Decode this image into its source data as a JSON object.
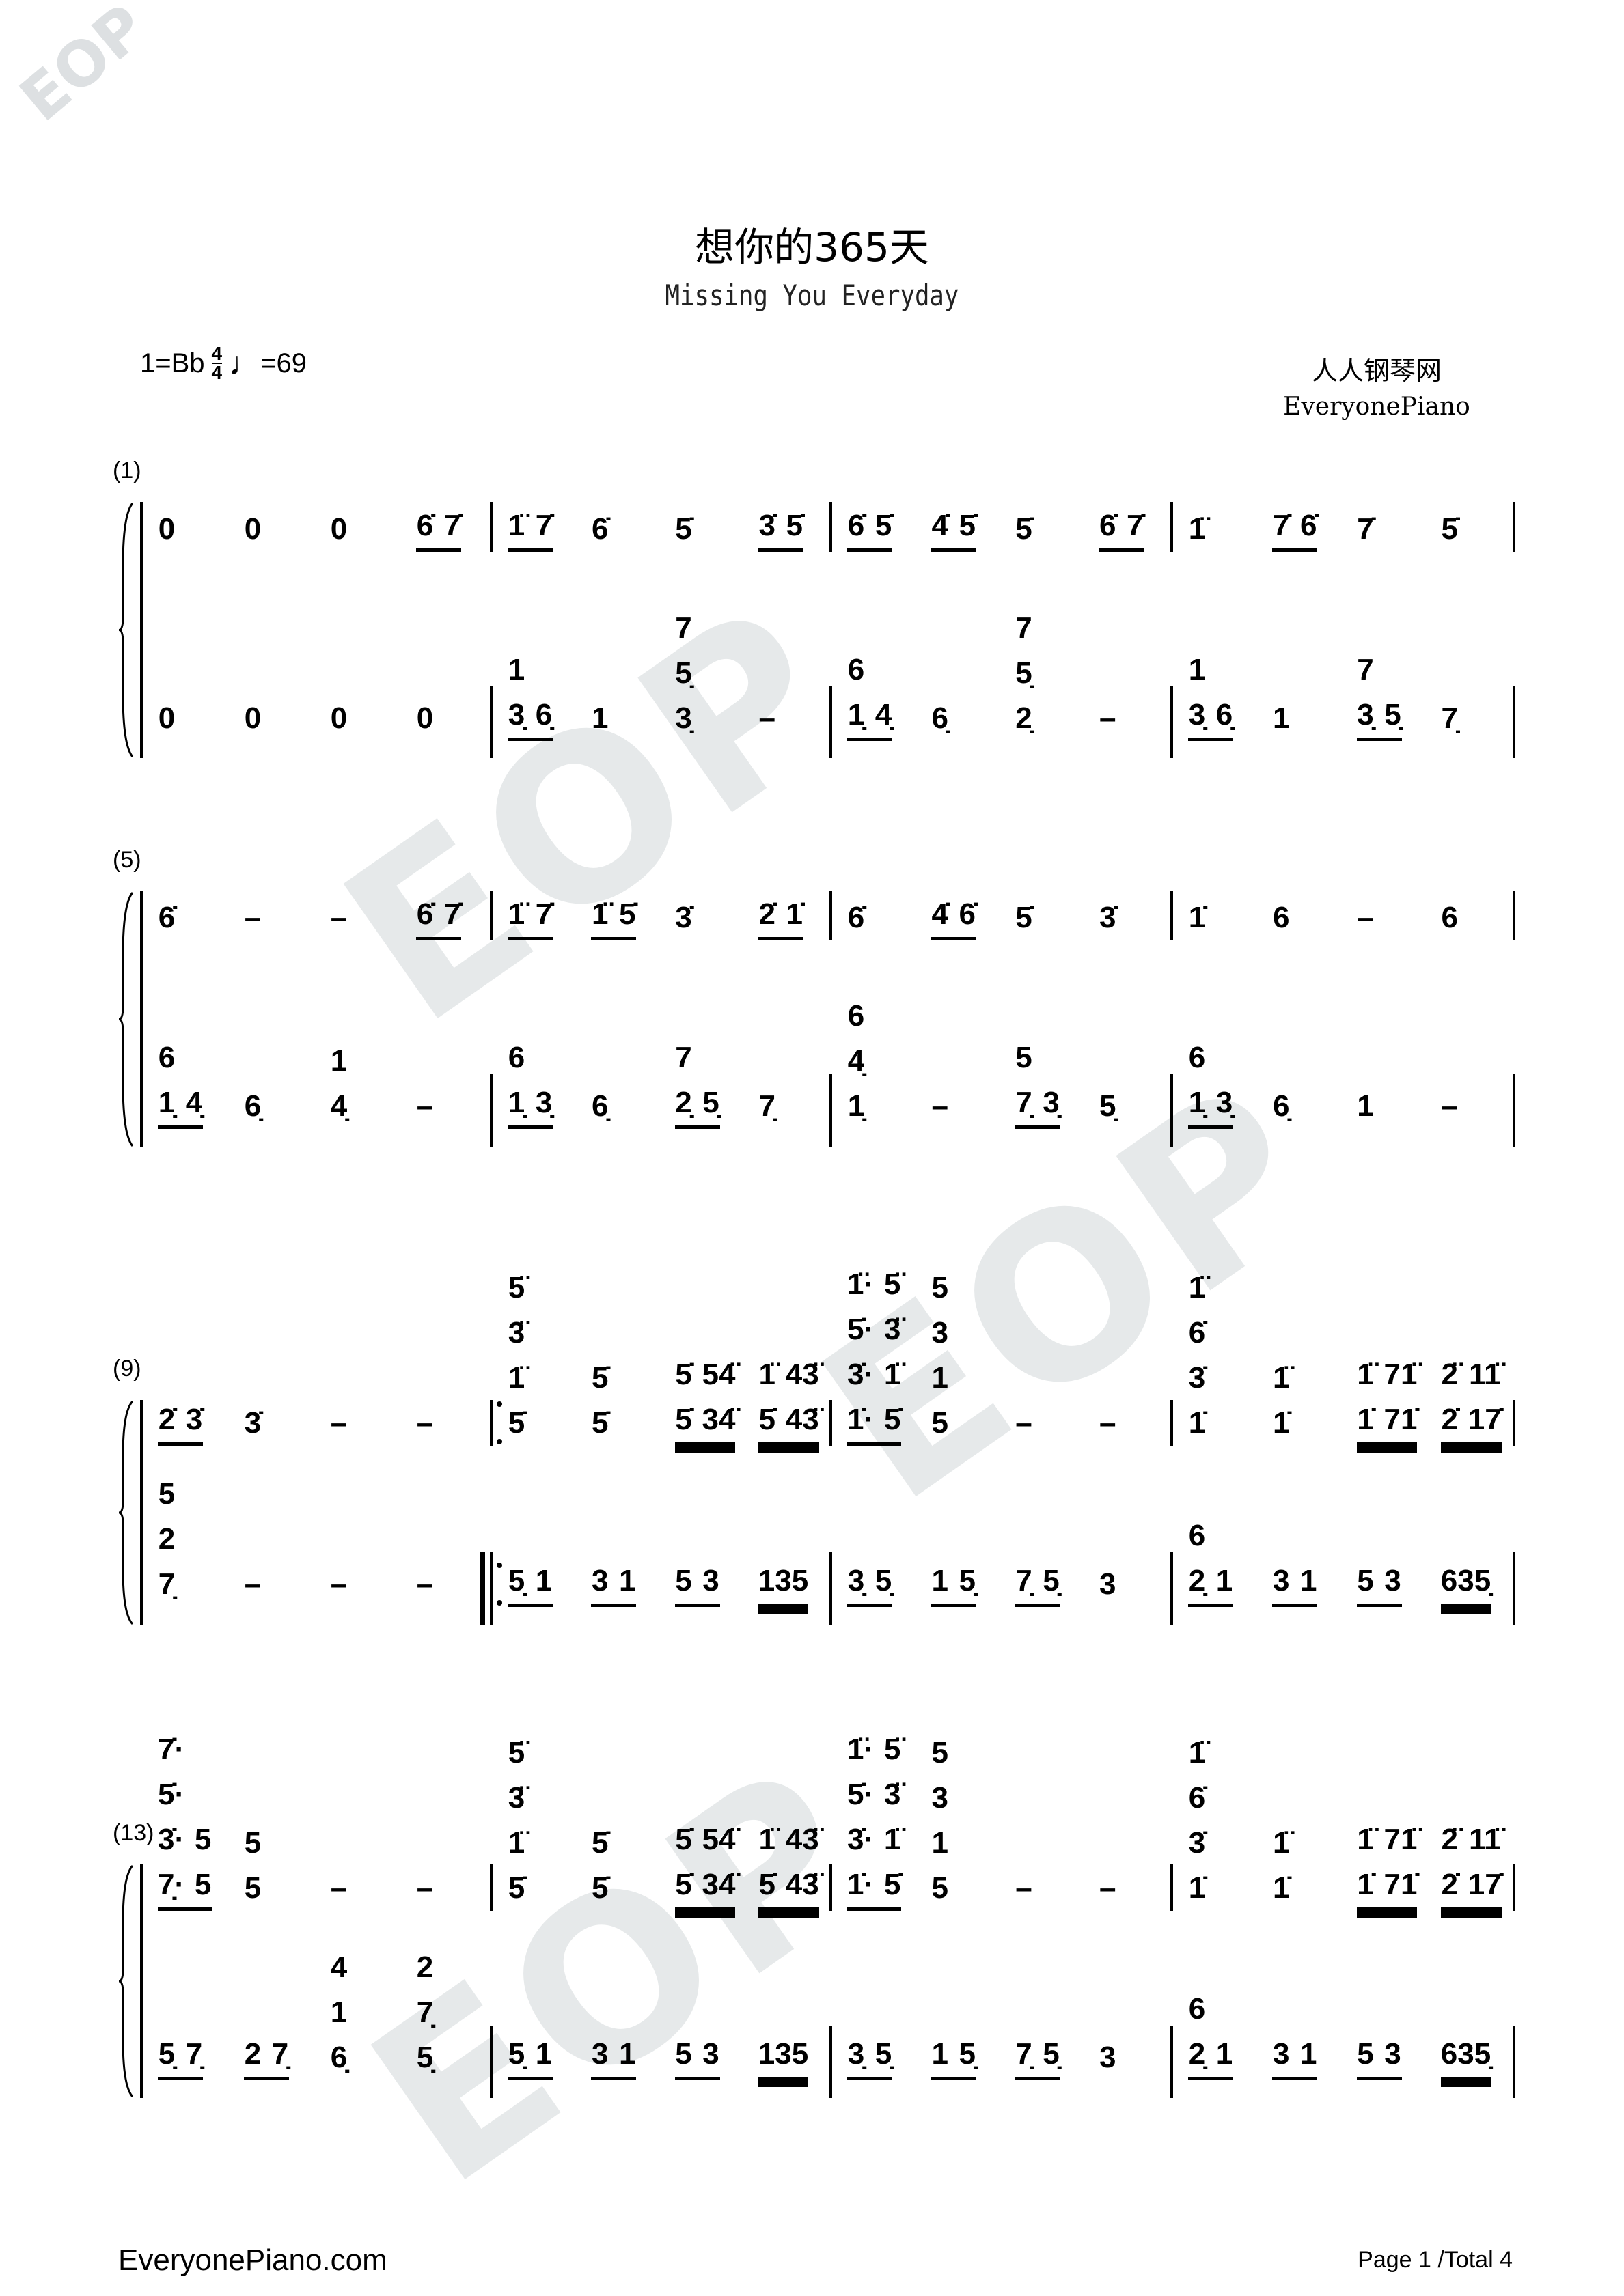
{
  "title": "想你的365天",
  "subtitle": "Missing You Everyday",
  "key": "1=Bb",
  "time_signature": {
    "top": "4",
    "bottom": "4"
  },
  "tempo": "=69",
  "site_cn": "人人钢琴网",
  "site_en": "EveryonePiano",
  "watermark": "EOP",
  "footer": {
    "site": "EveryonePiano.com",
    "page": "Page 1 /Total 4"
  },
  "systems": [
    {
      "label": "(1)",
      "measures": [
        {
          "rh": [
            "0",
            "0",
            "0",
            {
              "u": 1,
              "ev": [
                "6̇",
                "7̇"
              ]
            }
          ],
          "lh": [
            "0",
            "0",
            "0",
            "0"
          ]
        },
        {
          "rh": [
            {
              "u": 1,
              "ev": [
                "1̈",
                "7̇"
              ]
            },
            "6̇",
            "5̇",
            {
              "u": 1,
              "ev": [
                "3̇",
                "5̇"
              ]
            }
          ],
          "lh": [
            {
              "u": 1,
              "ev": [
                "1/3̣",
                "6̣"
              ]
            },
            "1",
            "7/5̣/3̣",
            "–"
          ]
        },
        {
          "rh": [
            {
              "u": 1,
              "ev": [
                "6̇",
                "5̇"
              ]
            },
            {
              "u": 1,
              "ev": [
                "4̇",
                "5̇"
              ]
            },
            "5̇",
            {
              "u": 1,
              "ev": [
                "6̇",
                "7̇"
              ]
            }
          ],
          "lh": [
            {
              "u": 1,
              "ev": [
                "6/1̣",
                "4̣"
              ]
            },
            "6̣",
            "7/5̣/2̣",
            "–"
          ]
        },
        {
          "rh": [
            "1̈",
            {
              "u": 1,
              "ev": [
                "7̇",
                "6̇"
              ]
            },
            "7̇",
            "5̇"
          ],
          "lh": [
            {
              "u": 1,
              "ev": [
                "1/3̣",
                "6̣"
              ]
            },
            "1",
            {
              "u": 1,
              "ev": [
                "7/3̣",
                "5̣"
              ]
            },
            "7̣"
          ]
        }
      ]
    },
    {
      "label": "(5)",
      "measures": [
        {
          "rh": [
            "6̇",
            "–",
            "–",
            {
              "u": 1,
              "ev": [
                "6̇",
                "7̇"
              ]
            }
          ],
          "lh": [
            {
              "u": 1,
              "ev": [
                "6/1̣",
                "4̣"
              ]
            },
            "6̣",
            "1/4̣",
            "–"
          ]
        },
        {
          "rh": [
            {
              "u": 1,
              "ev": [
                "1̈",
                "7̇"
              ]
            },
            {
              "u": 1,
              "ev": [
                "1̈",
                "5̇"
              ]
            },
            "3̇",
            {
              "u": 1,
              "ev": [
                "2̇",
                "1̇"
              ]
            }
          ],
          "lh": [
            {
              "u": 1,
              "ev": [
                "6/1̣",
                "3̣"
              ]
            },
            "6̣",
            {
              "u": 1,
              "ev": [
                "7/2̣",
                "5̣"
              ]
            },
            "7̣"
          ]
        },
        {
          "rh": [
            "6̇",
            {
              "u": 1,
              "ev": [
                "4̇",
                "6̇"
              ]
            },
            "5̇",
            "3̇"
          ],
          "lh": [
            "6/4̣/1̣",
            "–",
            {
              "u": 1,
              "ev": [
                "5/7̣",
                "3̣"
              ]
            },
            "5̣"
          ]
        },
        {
          "rh": [
            "1̇",
            "6",
            "–",
            "6"
          ],
          "lh": [
            {
              "u": 1,
              "ev": [
                "6/1̣",
                "3̣"
              ]
            },
            "6̣",
            "1",
            "–"
          ]
        }
      ]
    },
    {
      "label": "(9)",
      "measures": [
        {
          "rh": [
            {
              "u": 1,
              "ev": [
                "2̇",
                "3̇"
              ]
            },
            "3̇",
            "–",
            "–"
          ],
          "lh": [
            "5/2/7̣",
            "–",
            "–",
            "–"
          ]
        },
        {
          "repeat_start": true,
          "rh": [
            "5̈/3̈/1̈/5̇",
            "5̇/5̇",
            {
              "u": 2,
              "ev": [
                "5̇/5̇",
                "54̈/34̈"
              ]
            },
            {
              "u": 2,
              "ev": [
                "1̈/5̇",
                "43̈/43̈"
              ]
            }
          ],
          "lh": [
            {
              "u": 1,
              "ev": [
                "5̣",
                "1"
              ]
            },
            {
              "u": 1,
              "ev": [
                "3",
                "1"
              ]
            },
            {
              "u": 1,
              "ev": [
                "5",
                "3"
              ]
            },
            {
              "u": 2,
              "ev": [
                "135"
              ]
            }
          ]
        },
        {
          "rh": [
            {
              "u": 1,
              "ev": [
                "1̈·/5̇·/3̇·/1̇·",
                "5̈/3̈/1̈/5̇"
              ]
            },
            "5/3/1/5",
            "–",
            "–"
          ],
          "lh": [
            {
              "u": 1,
              "ev": [
                "3̣",
                "5̣"
              ]
            },
            {
              "u": 1,
              "ev": [
                "1",
                "5̣"
              ]
            },
            {
              "u": 1,
              "ev": [
                "7̣",
                "5̣"
              ]
            },
            "3"
          ]
        },
        {
          "rh": [
            "1̈/6̇/3̇/1̇",
            "1̈/1̇",
            {
              "u": 2,
              "ev": [
                "1̈/1̇",
                "71̈/71̇"
              ]
            },
            {
              "u": 2,
              "ev": [
                "2̈/2̇",
                "11̈/17̇"
              ]
            }
          ],
          "lh": [
            {
              "u": 1,
              "ev": [
                "6/2̣",
                "1"
              ]
            },
            {
              "u": 1,
              "ev": [
                "3",
                "1"
              ]
            },
            {
              "u": 1,
              "ev": [
                "5",
                "3"
              ]
            },
            {
              "u": 2,
              "ev": [
                "635̣"
              ]
            }
          ]
        }
      ]
    },
    {
      "label": "(13)",
      "measures": [
        {
          "rh": [
            {
              "u": 1,
              "ev": [
                "7̇·/5̇·/3̇·/7̣·",
                "5/5"
              ]
            },
            "5/5",
            "–",
            "–"
          ],
          "lh": [
            {
              "u": 1,
              "ev": [
                "5̣",
                "7̣"
              ]
            },
            {
              "u": 1,
              "ev": [
                "2",
                "7̣"
              ]
            },
            "4/1/6̣",
            "2/7̣/5̣"
          ]
        },
        {
          "rh": [
            "5̈/3̈/1̈/5̇",
            "5̇/5̇",
            {
              "u": 2,
              "ev": [
                "5̇/5̇",
                "54̈/34̈"
              ]
            },
            {
              "u": 2,
              "ev": [
                "1̈/5̇",
                "43̈/43̈"
              ]
            }
          ],
          "lh": [
            {
              "u": 1,
              "ev": [
                "5̣",
                "1"
              ]
            },
            {
              "u": 1,
              "ev": [
                "3",
                "1"
              ]
            },
            {
              "u": 1,
              "ev": [
                "5",
                "3"
              ]
            },
            {
              "u": 2,
              "ev": [
                "135"
              ]
            }
          ]
        },
        {
          "rh": [
            {
              "u": 1,
              "ev": [
                "1̈·/5̇·/3̇·/1̇·",
                "5̈/3̈/1̈/5̇"
              ]
            },
            "5/3/1/5",
            "–",
            "–"
          ],
          "lh": [
            {
              "u": 1,
              "ev": [
                "3̣",
                "5̣"
              ]
            },
            {
              "u": 1,
              "ev": [
                "1",
                "5̣"
              ]
            },
            {
              "u": 1,
              "ev": [
                "7̣",
                "5̣"
              ]
            },
            "3"
          ]
        },
        {
          "rh": [
            "1̈/6̇/3̇/1̇",
            "1̈/1̇",
            {
              "u": 2,
              "ev": [
                "1̈/1̇",
                "71̈/71̇"
              ]
            },
            {
              "u": 2,
              "ev": [
                "2̈/2̇",
                "11̈/17̇"
              ]
            }
          ],
          "lh": [
            {
              "u": 1,
              "ev": [
                "6/2̣",
                "1"
              ]
            },
            {
              "u": 1,
              "ev": [
                "3",
                "1"
              ]
            },
            {
              "u": 1,
              "ev": [
                "5",
                "3"
              ]
            },
            {
              "u": 2,
              "ev": [
                "635̣"
              ]
            }
          ]
        }
      ]
    }
  ]
}
